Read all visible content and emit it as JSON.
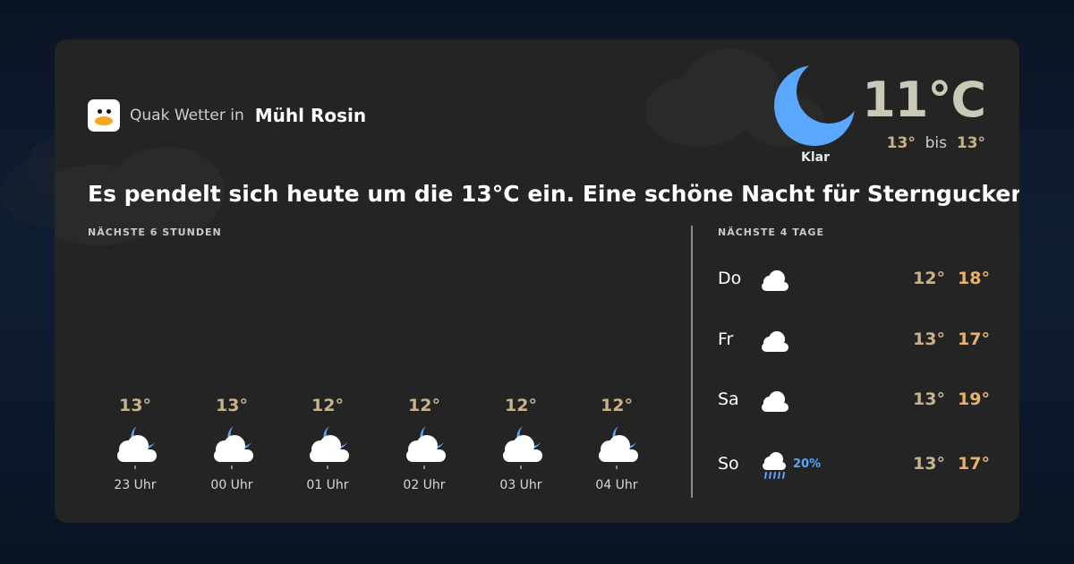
{
  "header": {
    "brand": "Quak Wetter in",
    "town": "Mühl Rosin"
  },
  "current": {
    "condition": "Klar",
    "icon": "moon-icon",
    "temperature": "11°C",
    "range_low": "13°",
    "range_sep": "bis",
    "range_high": "13°"
  },
  "headline": "Es pendelt sich heute um die 13°C ein. Eine schöne Nacht für Sterngucker.",
  "hourly": {
    "label": "NÄCHSTE 6 STUNDEN",
    "items": [
      {
        "temp": "13°",
        "time": "23 Uhr",
        "icon": "partly-cloudy-night-icon"
      },
      {
        "temp": "13°",
        "time": "00 Uhr",
        "icon": "partly-cloudy-night-icon"
      },
      {
        "temp": "12°",
        "time": "01 Uhr",
        "icon": "partly-cloudy-night-icon"
      },
      {
        "temp": "12°",
        "time": "02 Uhr",
        "icon": "partly-cloudy-night-icon"
      },
      {
        "temp": "12°",
        "time": "03 Uhr",
        "icon": "partly-cloudy-night-icon"
      },
      {
        "temp": "12°",
        "time": "04 Uhr",
        "icon": "partly-cloudy-night-icon"
      }
    ]
  },
  "daily": {
    "label": "NÄCHSTE 4 TAGE",
    "items": [
      {
        "day": "Do",
        "icon": "cloud-icon",
        "precip": "",
        "low": "12°",
        "high": "18°"
      },
      {
        "day": "Fr",
        "icon": "cloud-icon",
        "precip": "",
        "low": "13°",
        "high": "17°"
      },
      {
        "day": "Sa",
        "icon": "cloud-icon",
        "precip": "",
        "low": "13°",
        "high": "19°"
      },
      {
        "day": "So",
        "icon": "rain-cloud-icon",
        "precip": "20%",
        "low": "13°",
        "high": "17°"
      }
    ]
  },
  "colors": {
    "card": "#242424",
    "moon": "#5aa7ff",
    "temp_low": "#c8b28c",
    "temp_high": "#e7b26a",
    "precip": "#5aa7ff"
  }
}
